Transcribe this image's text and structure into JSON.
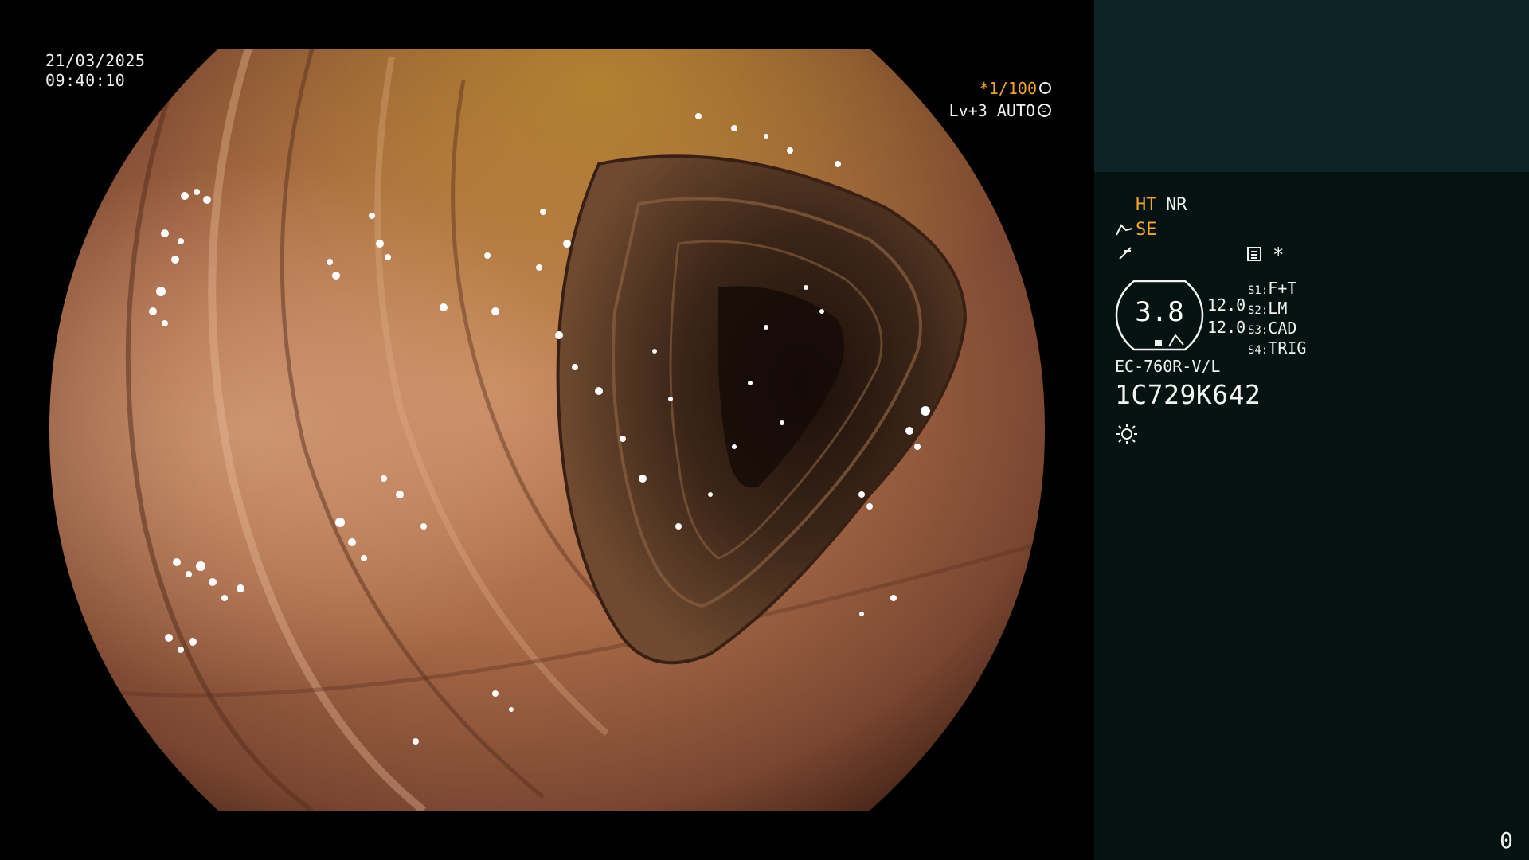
{
  "overlay": {
    "date": "21/03/2025",
    "time": "09:40:10",
    "shutter": "*1/100",
    "level_mode": "Lv+3 AUTO"
  },
  "panel": {
    "ht_label": "HT",
    "nr_label": "NR",
    "se_label": "SE",
    "asterisk": "*",
    "center_value": "3.8",
    "side_value_1": "12.0",
    "side_value_2": "12.0",
    "switches": [
      {
        "key": "S1",
        "value": "F+T"
      },
      {
        "key": "S2",
        "value": "LM"
      },
      {
        "key": "S3",
        "value": "CAD"
      },
      {
        "key": "S4",
        "value": "TRIG"
      }
    ],
    "scope_model": "EC-760R-V/L",
    "serial": "1C729K642",
    "counter": "0"
  },
  "colors": {
    "accent_orange": "#f4a526",
    "panel_top": "#0d2326",
    "panel_bottom": "#041310",
    "text": "#f2f2f2"
  },
  "icons": [
    "shutter-icon",
    "ring-icon",
    "scope-hand-icon",
    "freeze-icon",
    "menu-icon",
    "light-icon"
  ]
}
